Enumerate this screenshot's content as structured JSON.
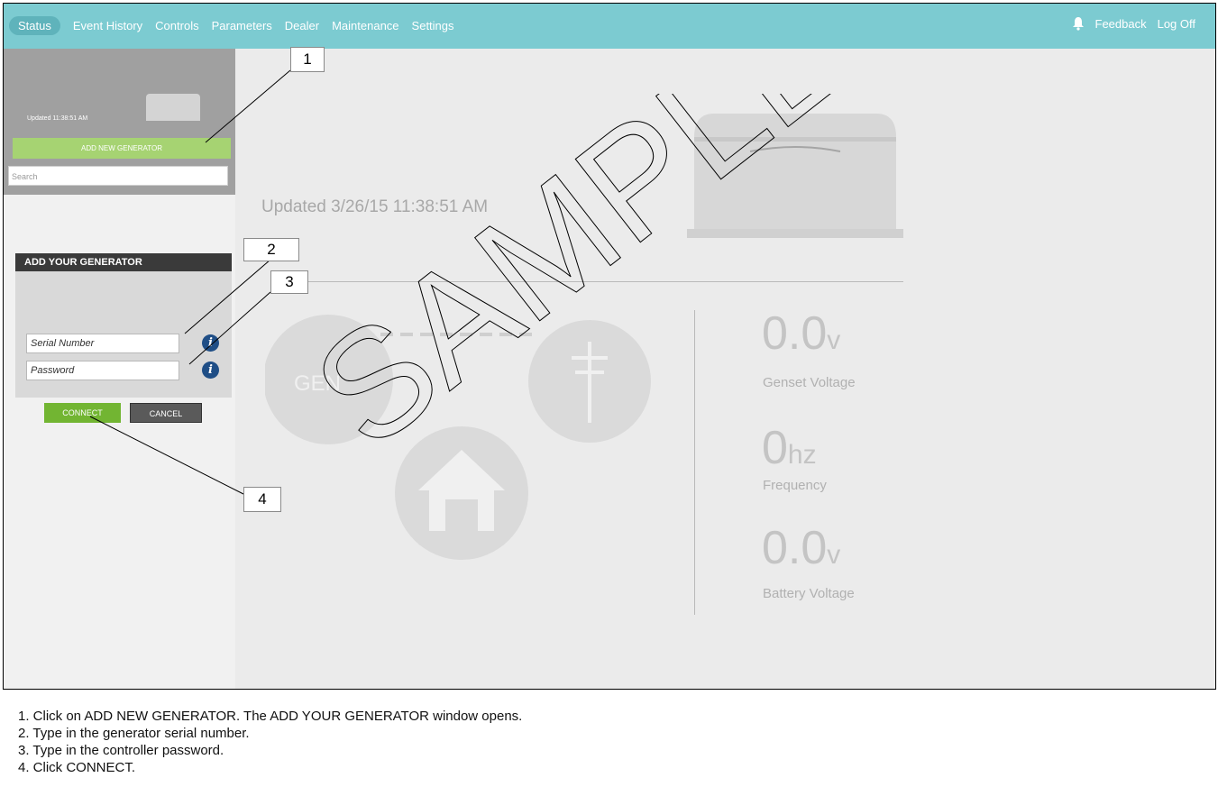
{
  "nav": {
    "items": [
      "Status",
      "Event History",
      "Controls",
      "Parameters",
      "Dealer",
      "Maintenance",
      "Settings"
    ],
    "active": "Status",
    "feedback": "Feedback",
    "logoff": "Log Off",
    "notification_icon": "bell-icon"
  },
  "sidebar": {
    "updated": "Updated 11:38:51 AM",
    "add_button": "ADD NEW GENERATOR",
    "search_placeholder": "Search"
  },
  "dialog": {
    "title": "ADD YOUR GENERATOR",
    "serial_placeholder": "Serial Number",
    "password_placeholder": "Password",
    "info_glyph": "i",
    "connect": "CONNECT",
    "cancel": "CANCEL"
  },
  "main": {
    "updated": "Updated 3/26/15 11:38:51 AM",
    "gen_circle_text": "GEN",
    "watermark": "SAMPLE",
    "readings": [
      {
        "value": "0.0",
        "unit": "v",
        "label": "Genset Voltage"
      },
      {
        "value": "0",
        "unit": "hz",
        "label": "Frequency"
      },
      {
        "value": "0.0",
        "unit": "v",
        "label": "Battery Voltage"
      }
    ]
  },
  "callouts": [
    "1",
    "2",
    "3",
    "4"
  ],
  "instructions": [
    "1. Click on ADD NEW GENERATOR.  The ADD YOUR GENERATOR window opens.",
    "2. Type in the generator serial number.",
    "3. Type in the controller password.",
    "4. Click CONNECT."
  ],
  "colors": {
    "topbar": "#7ccbd1",
    "add_button": "#a6d372",
    "connect": "#72b532",
    "info": "#1f4e86"
  }
}
